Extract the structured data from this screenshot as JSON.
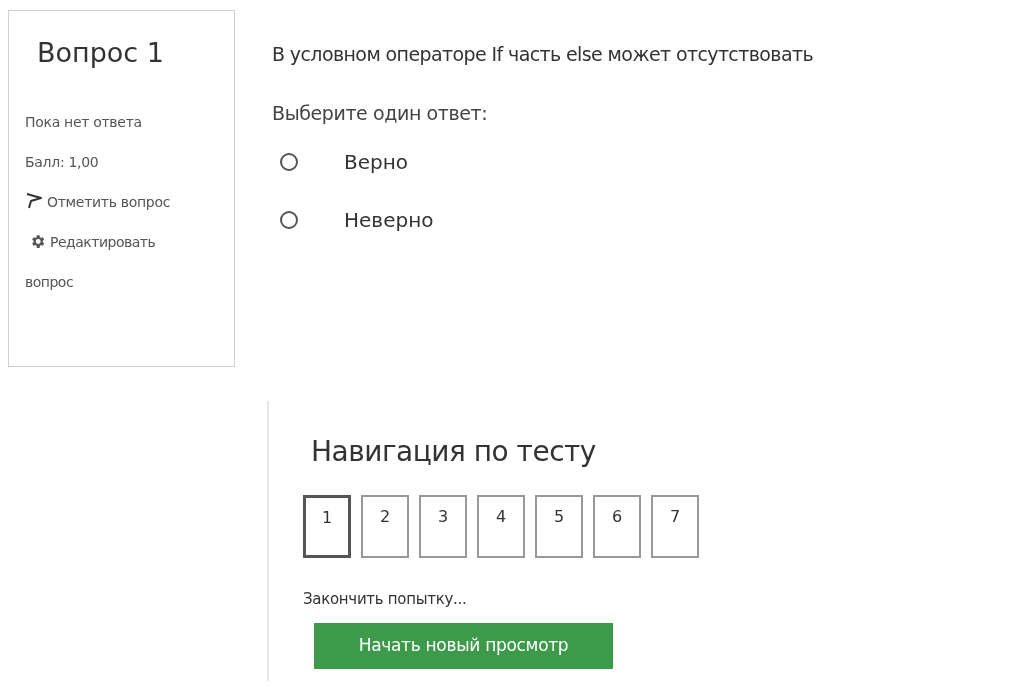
{
  "question_info": {
    "title": "Вопрос 1",
    "status": "Пока нет ответа",
    "grade": "Балл: 1,00",
    "flag_link": "Отметить вопрос",
    "edit_link": "Редактировать вопрос"
  },
  "question": {
    "text": "В условном операторе If часть else может отсутствовать",
    "prompt": "Выберите один ответ:",
    "options": [
      {
        "label": "Верно",
        "selected": false
      },
      {
        "label": "Неверно",
        "selected": false
      }
    ]
  },
  "navigation": {
    "title": "Навигация по тесту",
    "questions": [
      {
        "label": "1",
        "selected": true
      },
      {
        "label": "2",
        "selected": false
      },
      {
        "label": "3",
        "selected": false
      },
      {
        "label": "4",
        "selected": false
      },
      {
        "label": "5",
        "selected": false
      },
      {
        "label": "6",
        "selected": false
      },
      {
        "label": "7",
        "selected": false
      }
    ],
    "finish_link": "Закончить попытку...",
    "restart_button": "Начать новый просмотр"
  }
}
